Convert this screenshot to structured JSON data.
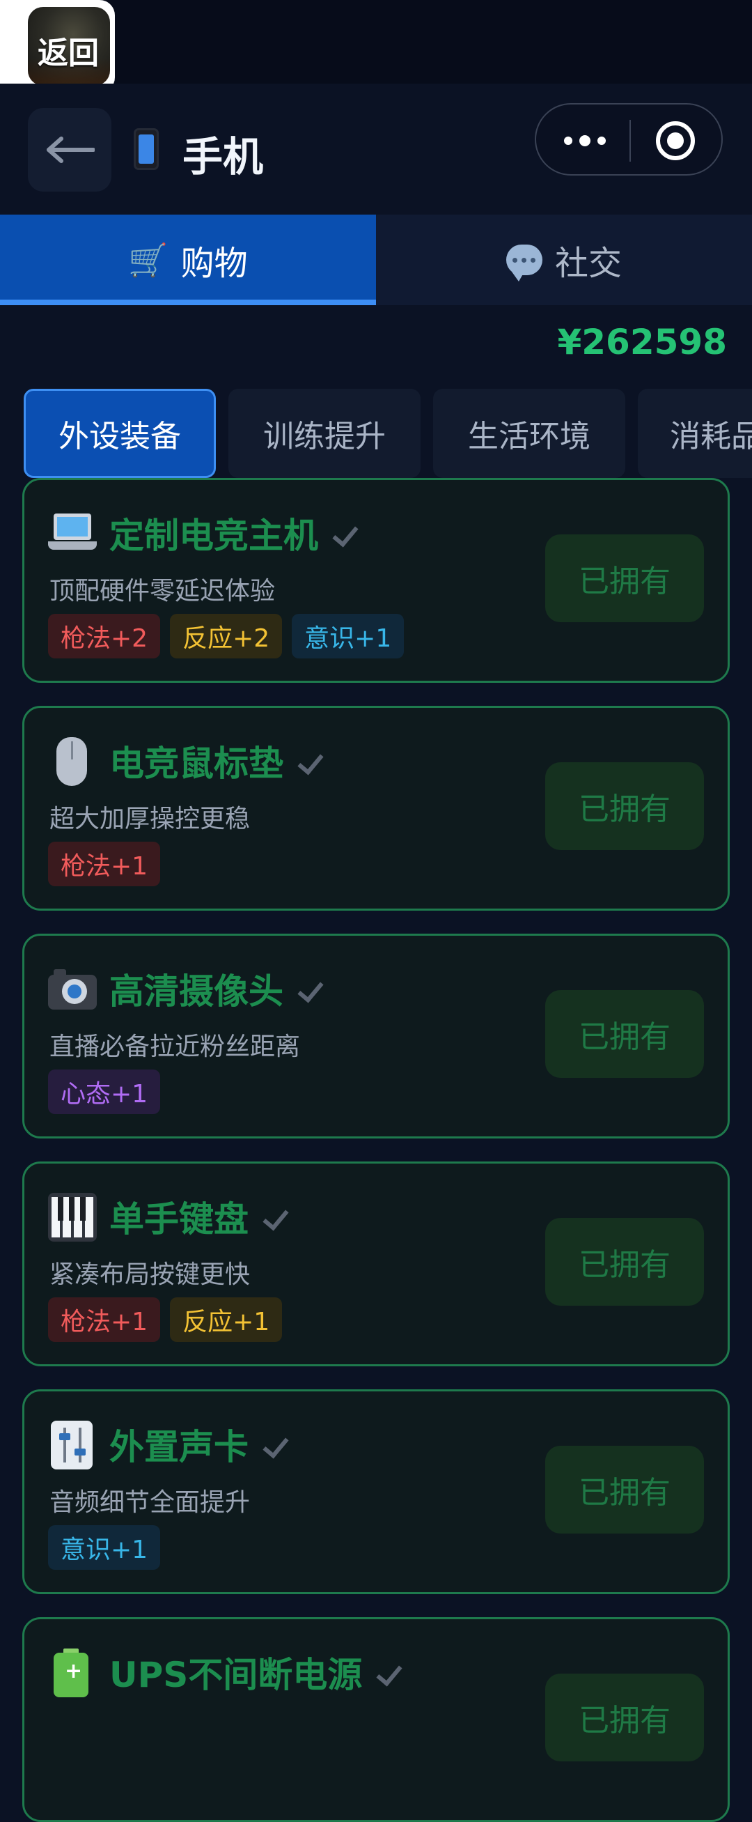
{
  "system": {
    "back_label": "返回"
  },
  "header": {
    "title": "手机"
  },
  "tabs": {
    "main": [
      {
        "label": "购物",
        "icon": "cart-icon",
        "active": true
      },
      {
        "label": "社交",
        "icon": "chat-bubble-icon",
        "active": false
      }
    ]
  },
  "balance": "¥262598",
  "categories": [
    "外设装备",
    "训练提升",
    "生活环境",
    "消耗品"
  ],
  "items": [
    {
      "icon": "laptop-icon",
      "name": "定制电竞主机",
      "desc": "顶配硬件零延迟体验",
      "tags": [
        "枪法+2",
        "反应+2",
        "意识+1"
      ],
      "button": "已拥有"
    },
    {
      "icon": "mouse-icon",
      "name": "电竞鼠标垫",
      "desc": "超大加厚操控更稳",
      "tags": [
        "枪法+1"
      ],
      "button": "已拥有"
    },
    {
      "icon": "camera-icon",
      "name": "高清摄像头",
      "desc": "直播必备拉近粉丝距离",
      "tags": [
        "心态+1"
      ],
      "button": "已拥有"
    },
    {
      "icon": "piano-keyboard-icon",
      "name": "单手键盘",
      "desc": "紧凑布局按键更快",
      "tags": [
        "枪法+1",
        "反应+1"
      ],
      "button": "已拥有"
    },
    {
      "icon": "mixer-icon",
      "name": "外置声卡",
      "desc": "音频细节全面提升",
      "tags": [
        "意识+1"
      ],
      "button": "已拥有"
    },
    {
      "icon": "battery-icon",
      "name": "UPS不间断电源",
      "desc": "",
      "tags": [],
      "button": "已拥有"
    }
  ],
  "colors": {
    "background": "#0b1224",
    "accent_blue": "#0b4fb2",
    "balance_green": "#25c274",
    "owned_green": "#1c8e4f",
    "tag_red": "#f15b5b",
    "tag_yellow": "#f3c234",
    "tag_blue": "#38b6e8",
    "tag_purple": "#b06cf4"
  }
}
